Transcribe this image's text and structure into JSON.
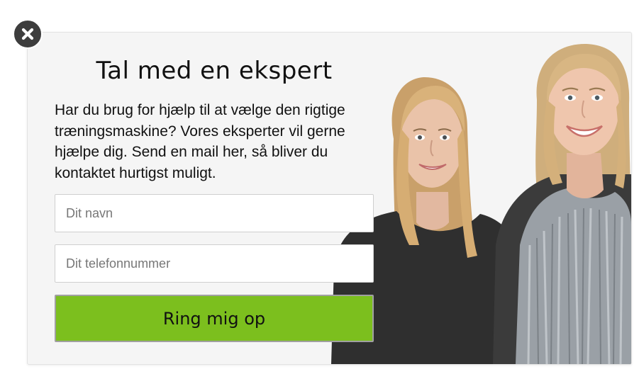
{
  "popup": {
    "title": "Tal med en ekspert",
    "description": "Har du brug for hjælp til at vælge den rigtige træningsmaskine? Vores eksperter vil gerne hjælpe dig. Send en mail her, så bliver du kontaktet hurtigst muligt.",
    "name_field": {
      "placeholder": "Dit navn",
      "value": ""
    },
    "phone_field": {
      "placeholder": "Dit telefonnummer",
      "value": ""
    },
    "submit_label": "Ring mig op",
    "close_icon": "close-icon",
    "colors": {
      "accent": "#7cbf1e",
      "background": "#f5f5f5",
      "close_button": "#3d3d3d"
    }
  }
}
